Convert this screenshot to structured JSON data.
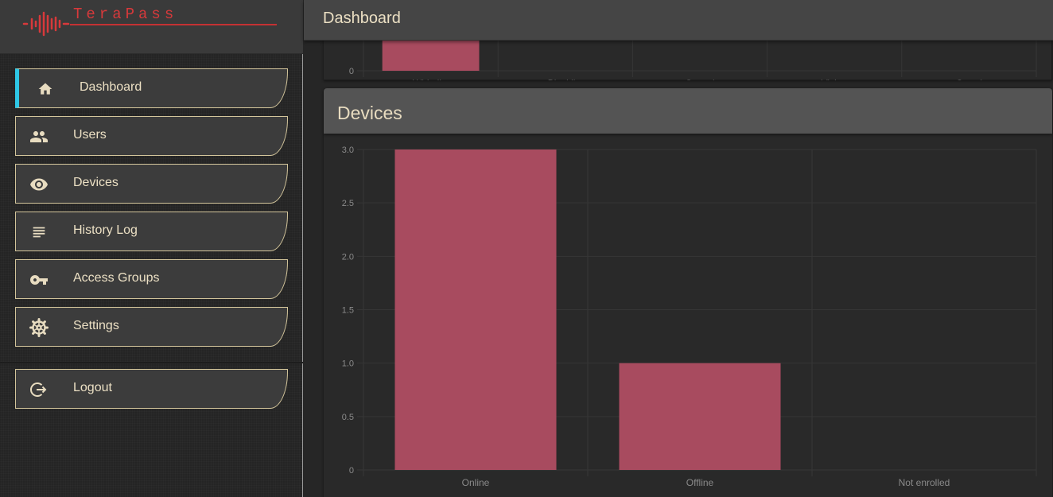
{
  "app": {
    "brand": "TeraPass"
  },
  "header": {
    "title": "Dashboard"
  },
  "sidebar": {
    "items": [
      {
        "key": "dashboard",
        "label": "Dashboard",
        "icon": "home-icon",
        "active": true
      },
      {
        "key": "users",
        "label": "Users",
        "icon": "users-icon",
        "active": false
      },
      {
        "key": "devices",
        "label": "Devices",
        "icon": "eye-icon",
        "active": false
      },
      {
        "key": "history-log",
        "label": "History Log",
        "icon": "list-icon",
        "active": false
      },
      {
        "key": "access-groups",
        "label": "Access Groups",
        "icon": "key-icon",
        "active": false
      },
      {
        "key": "settings",
        "label": "Settings",
        "icon": "gear-icon",
        "active": false
      }
    ],
    "logout": {
      "label": "Logout",
      "icon": "logout-icon"
    }
  },
  "colors": {
    "accent": "#2ec7e6",
    "brand": "#d8393b",
    "bar": "#a84b5f",
    "nav_border": "#d3c59b"
  },
  "chart_data": [
    {
      "type": "bar",
      "title": "",
      "categories": [
        "Whitelist",
        "Blacklist",
        "Casual",
        "Visitor",
        "Guard"
      ],
      "visible_ticks": [
        "0"
      ],
      "note_partial": "only bottom of chart visible; Whitelist bar is non-zero"
    },
    {
      "type": "bar",
      "title": "Devices",
      "categories": [
        "Online",
        "Offline",
        "Not enrolled"
      ],
      "values": [
        3,
        1,
        0
      ],
      "ylim": [
        0,
        3.0
      ],
      "yticks": [
        "0",
        "0.5",
        "1.0",
        "1.5",
        "2.0",
        "2.5",
        "3.0"
      ],
      "grid": true,
      "xlabel": "",
      "ylabel": ""
    }
  ]
}
